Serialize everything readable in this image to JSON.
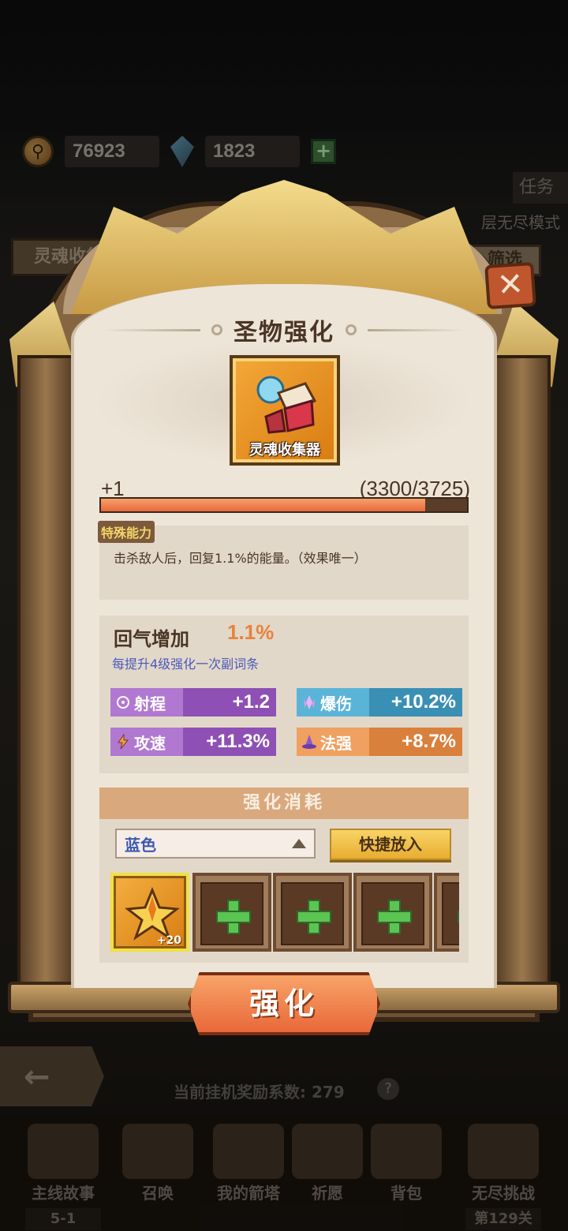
{
  "currency": {
    "coins": "76923",
    "gems": "1823",
    "add_label": "+"
  },
  "background": {
    "left_tab": "灵魂收集",
    "task_label": "任务",
    "mode_label": "层无尽模式",
    "filter_label": "筛选",
    "reward_text": "当前挂机奖励系数: 279",
    "reward_help": "?",
    "back_glyph": "←",
    "nav": [
      {
        "label": "主线故事",
        "sub": "5-1"
      },
      {
        "label": "召唤"
      },
      {
        "label": "我的箭塔"
      },
      {
        "label": "祈愿"
      },
      {
        "label": "背包"
      },
      {
        "label": "无尽挑战",
        "sub": "第129关"
      }
    ]
  },
  "modal": {
    "title": "圣物强化",
    "close_glyph": "✕",
    "item": {
      "name": "灵魂收集器",
      "level": "+1",
      "exp_current": 3300,
      "exp_max": 3725,
      "exp_text": "(3300/3725)"
    },
    "special": {
      "tag": "特殊能力",
      "text": "击杀敌人后，回复1.1%的能量。（效果唯一）"
    },
    "main_stat": {
      "label": "回气增加",
      "value": "1.1%",
      "hint": "每提升4级强化一次副词条"
    },
    "sub_stats": [
      {
        "name": "射程",
        "value": "+1.2",
        "color": "#8e50b4",
        "icon": "crosshair-icon"
      },
      {
        "name": "爆伤",
        "value": "+10.2%",
        "color": "#3a8fb5",
        "icon": "crystal-icon"
      },
      {
        "name": "攻速",
        "value": "+11.3%",
        "color": "#8e50b4",
        "icon": "lightning-icon"
      },
      {
        "name": "法强",
        "value": "+8.7%",
        "color": "#d9803c",
        "icon": "wizard-hat-icon"
      }
    ],
    "cost": {
      "header": "强化消耗",
      "select_value": "蓝色",
      "quick_label": "快捷放入",
      "slots": [
        {
          "filled": true,
          "count": "+20",
          "icon": "star-shard-icon"
        },
        {
          "filled": false
        },
        {
          "filled": false
        },
        {
          "filled": false
        },
        {
          "filled": false
        }
      ]
    },
    "enhance_label": "强化"
  }
}
